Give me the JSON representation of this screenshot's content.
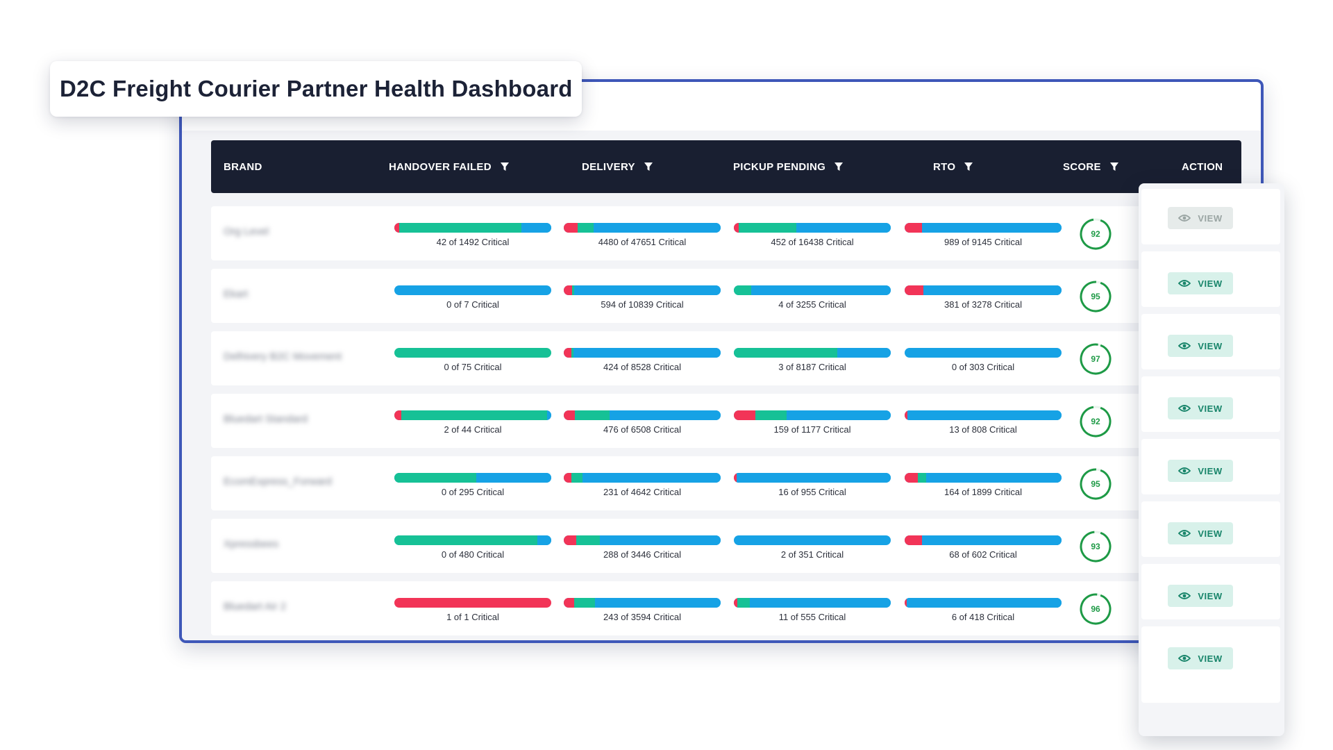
{
  "title": "D2C Freight Courier Partner Health Dashboard",
  "colors": {
    "critical": "#f23457",
    "healthy": "#16c196",
    "total": "#16a2e5",
    "score": "#1e9a46",
    "frame": "#3e57b8",
    "header": "#191f31"
  },
  "header": {
    "brand": "BRAND",
    "handover_failed": "HANDOVER FAILED",
    "delivery": "DELIVERY",
    "pickup_pending": "PICKUP PENDING",
    "rto": "RTO",
    "score": "SCORE",
    "action": "ACTION",
    "filter_icon": "filter-icon"
  },
  "rows": [
    {
      "brand": "Org Level",
      "handover": {
        "label": "42 of 1492 Critical",
        "red": 0.03,
        "green": 0.78
      },
      "delivery": {
        "label": "4480 of 47651 Critical",
        "red": 0.09,
        "green": 0.1
      },
      "pickup": {
        "label": "452 of 16438 Critical",
        "red": 0.03,
        "green": 0.37
      },
      "rto": {
        "label": "989 of 9145 Critical",
        "red": 0.11,
        "green": 0.0
      },
      "score": "92",
      "score_value": 92,
      "action": {
        "label": "VIEW",
        "disabled": true
      }
    },
    {
      "brand": "Ekart",
      "handover": {
        "label": "0 of 7 Critical",
        "red": 0.0,
        "green": 0.0
      },
      "delivery": {
        "label": "594 of 10839 Critical",
        "red": 0.055,
        "green": 0.01
      },
      "pickup": {
        "label": "4 of 3255 Critical",
        "red": 0.0,
        "green": 0.11
      },
      "rto": {
        "label": "381 of 3278 Critical",
        "red": 0.12,
        "green": 0.0
      },
      "score": "95",
      "score_value": 95,
      "action": {
        "label": "VIEW",
        "disabled": false
      }
    },
    {
      "brand": "Delhivery B2C Movement",
      "handover": {
        "label": "0 of 75 Critical",
        "red": 0.0,
        "green": 1.0
      },
      "delivery": {
        "label": "424 of 8528 Critical",
        "red": 0.05,
        "green": 0.01
      },
      "pickup": {
        "label": "3 of 8187 Critical",
        "red": 0.0,
        "green": 0.66
      },
      "rto": {
        "label": "0 of 303 Critical",
        "red": 0.0,
        "green": 0.0
      },
      "score": "97",
      "score_value": 97,
      "action": {
        "label": "VIEW",
        "disabled": false
      }
    },
    {
      "brand": "Bluedart Standard",
      "handover": {
        "label": "2 of 44 Critical",
        "red": 0.045,
        "green": 0.93
      },
      "delivery": {
        "label": "476 of 6508 Critical",
        "red": 0.07,
        "green": 0.22
      },
      "pickup": {
        "label": "159 of 1177 Critical",
        "red": 0.135,
        "green": 0.2
      },
      "rto": {
        "label": "13 of 808 Critical",
        "red": 0.016,
        "green": 0.0
      },
      "score": "92",
      "score_value": 92,
      "action": {
        "label": "VIEW",
        "disabled": false
      }
    },
    {
      "brand": "EcomExpress_Forward",
      "handover": {
        "label": "0 of 295 Critical",
        "red": 0.0,
        "green": 0.52
      },
      "delivery": {
        "label": "231 of 4642 Critical",
        "red": 0.05,
        "green": 0.07
      },
      "pickup": {
        "label": "16 of 955 Critical",
        "red": 0.017,
        "green": 0.0
      },
      "rto": {
        "label": "164 of 1899 Critical",
        "red": 0.086,
        "green": 0.05
      },
      "score": "95",
      "score_value": 95,
      "action": {
        "label": "VIEW",
        "disabled": false
      }
    },
    {
      "brand": "Xpressbees",
      "handover": {
        "label": "0 of 480 Critical",
        "red": 0.0,
        "green": 0.91
      },
      "delivery": {
        "label": "288 of 3446 Critical",
        "red": 0.08,
        "green": 0.15
      },
      "pickup": {
        "label": "2 of 351 Critical",
        "red": 0.0,
        "green": 0.0
      },
      "rto": {
        "label": "68 of 602 Critical",
        "red": 0.11,
        "green": 0.0
      },
      "score": "93",
      "score_value": 93,
      "action": {
        "label": "VIEW",
        "disabled": false
      }
    },
    {
      "brand": "Bluedart Air 2",
      "handover": {
        "label": "1 of 1 Critical",
        "red": 1.0,
        "green": 0.0
      },
      "delivery": {
        "label": "243 of 3594 Critical",
        "red": 0.068,
        "green": 0.13
      },
      "pickup": {
        "label": "11 of 555 Critical",
        "red": 0.02,
        "green": 0.08
      },
      "rto": {
        "label": "6 of 418 Critical",
        "red": 0.014,
        "green": 0.0
      },
      "score": "96",
      "score_value": 96,
      "action": {
        "label": "VIEW",
        "disabled": false
      }
    },
    {
      "action": {
        "label": "VIEW",
        "disabled": false
      }
    }
  ],
  "icons": {
    "view": "eye-icon",
    "score": "score-ring"
  }
}
